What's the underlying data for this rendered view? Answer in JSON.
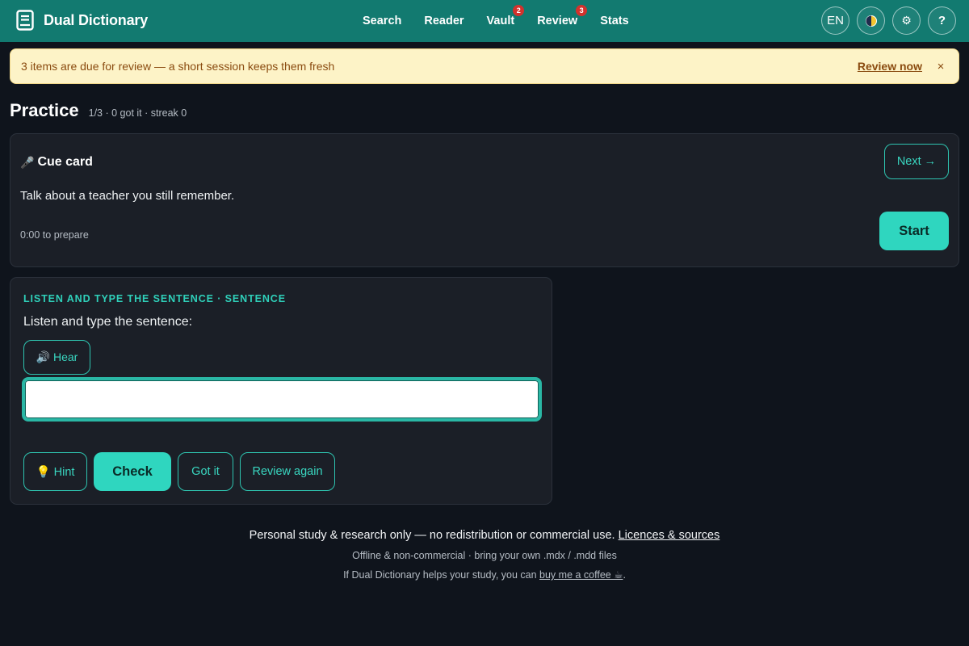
{
  "app": {
    "name": "Dual Dictionary",
    "brand_icon": "book-icon"
  },
  "nav": {
    "items": [
      {
        "label": "Search"
      },
      {
        "label": "Reader"
      },
      {
        "label": "Vault",
        "badge": "2"
      },
      {
        "label": "Review",
        "badge": "3"
      },
      {
        "label": "Stats"
      }
    ]
  },
  "actions": {
    "language": "EN",
    "theme_icon": "theme-toggle-icon",
    "settings_icon": "gear-icon",
    "help": "?"
  },
  "banner": {
    "text": "3 items are due for review — a short session keeps them fresh",
    "link": "Review now",
    "close": "×"
  },
  "practice": {
    "title": "Practice",
    "meta": "1/3 · 0 got it · streak 0"
  },
  "cue_card": {
    "icon": "🎤",
    "title": "Cue card",
    "prompt": "Talk about a teacher you still remember.",
    "prep": "0:00 to prepare",
    "next_label": "Next →",
    "start_label": "Start"
  },
  "listen": {
    "label": "LISTEN AND TYPE THE SENTENCE · SENTENCE",
    "question": "Listen and type the sentence:",
    "hear_label": "🔊 Hear",
    "input_value": "",
    "input_placeholder": "",
    "hint_label": "💡 Hint",
    "check_label": "Check",
    "got_label": "Got it",
    "again_label": "Review again"
  },
  "footer": {
    "line1": "Personal study & research only — no redistribution or commercial use. ",
    "line1_link": "Licences & sources",
    "line2": "Offline & non-commercial · bring your own .mdx / .mdd files",
    "line3_pre": "If Dual Dictionary helps your study, you can ",
    "line3_link": "buy me a coffee ☕",
    "line3_post": "."
  },
  "colors": {
    "topbar": "#127a70",
    "accent": "#2fd6bf",
    "banner_bg": "#fdf3c7",
    "banner_text": "#8a4b10",
    "page_bg": "#0f141c",
    "card_bg": "#1b1f27",
    "badge": "#d2322d"
  }
}
